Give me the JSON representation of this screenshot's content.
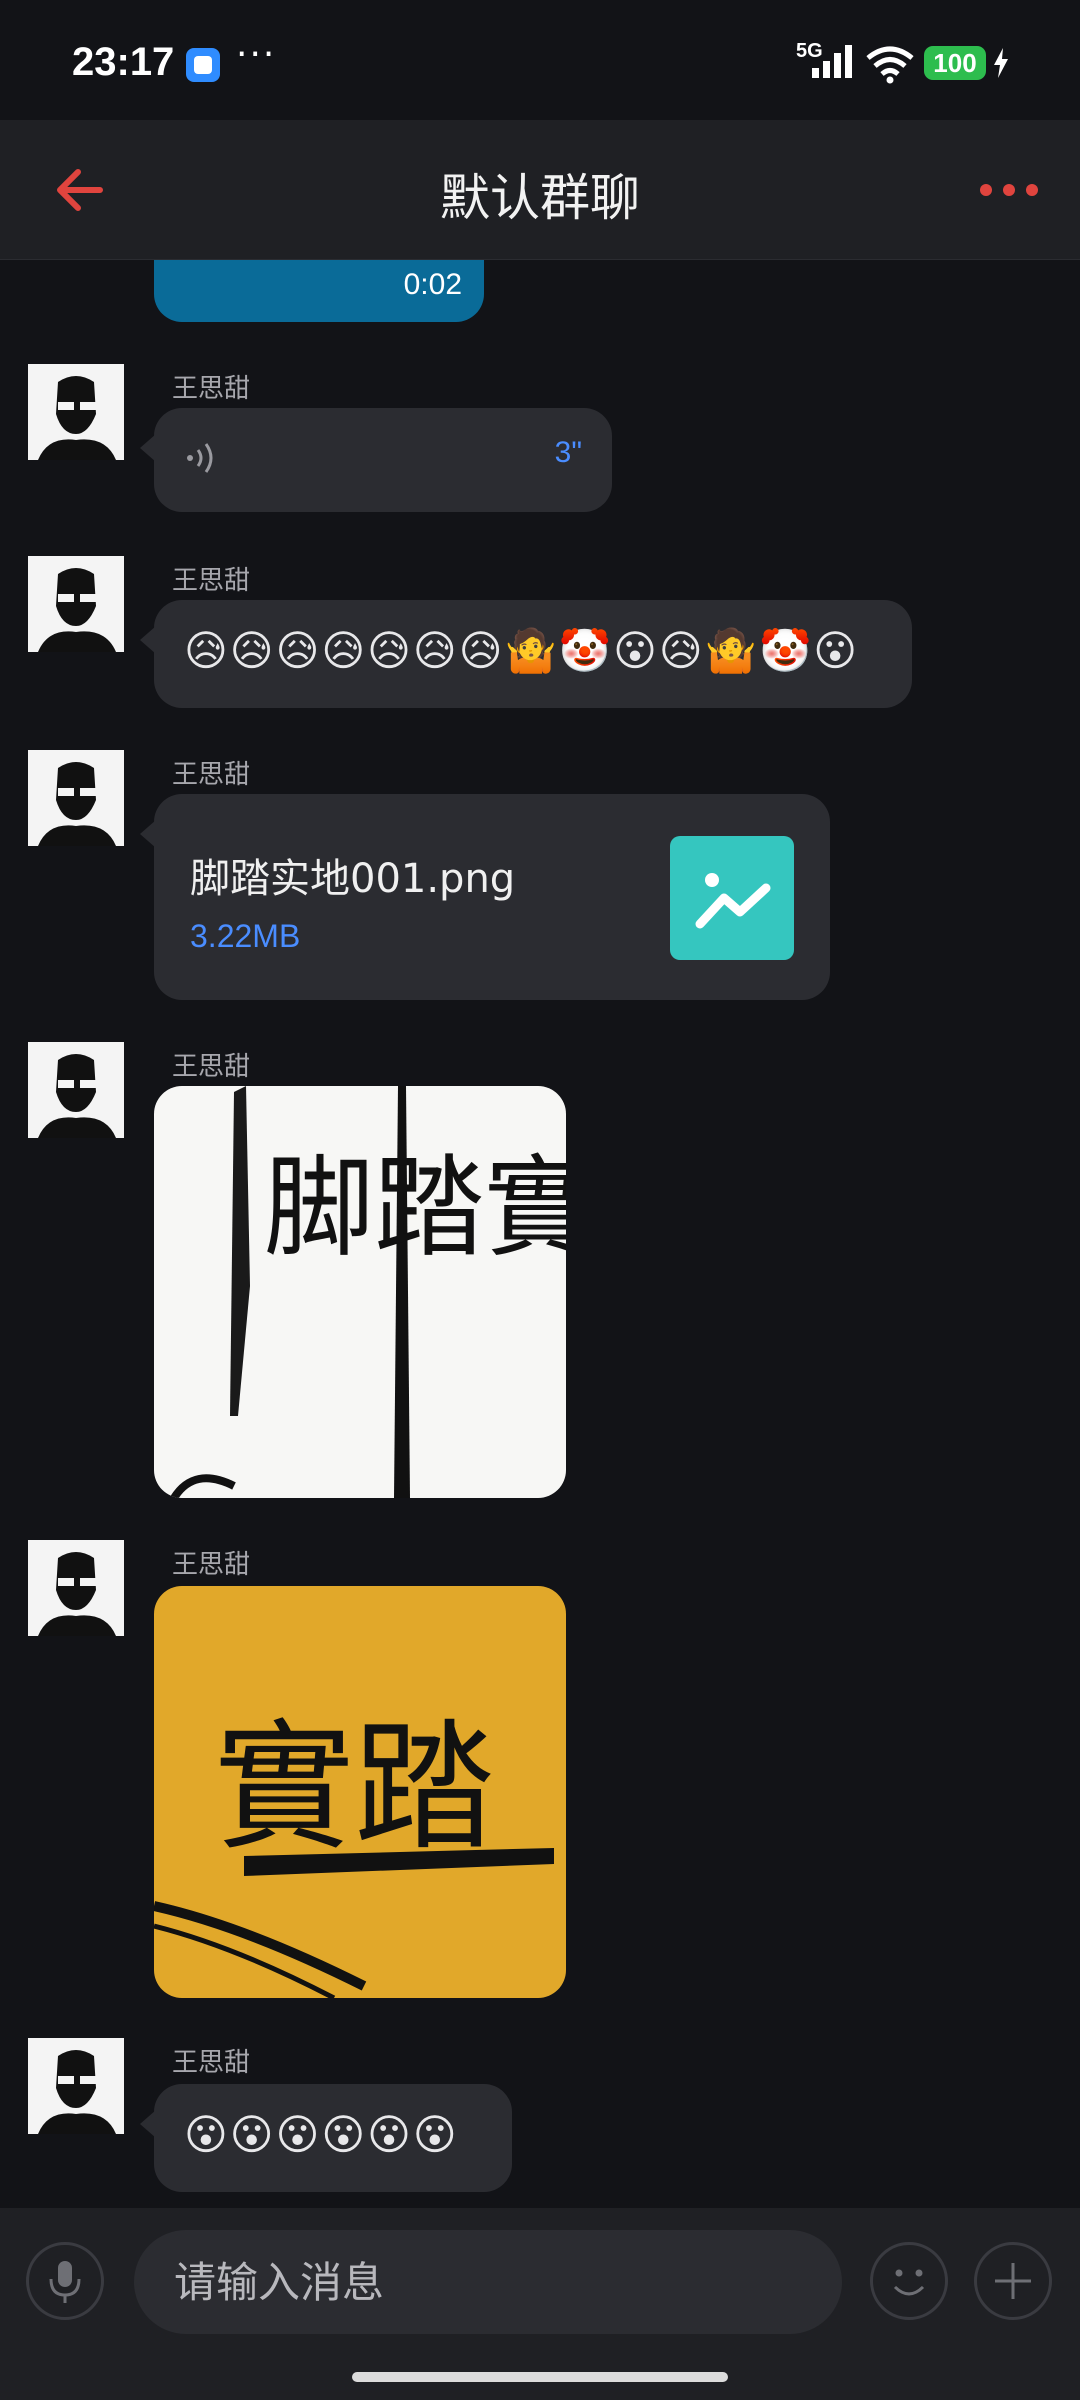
{
  "status_bar": {
    "time": "23:17",
    "more": "···",
    "network": "5G",
    "battery": "100"
  },
  "header": {
    "title": "默认群聊",
    "back_icon": "arrow-left-icon",
    "menu_icon": "more-dots-icon",
    "accent_color": "#e0443e"
  },
  "messages": {
    "own_voice": {
      "duration": "0:02"
    },
    "m1": {
      "sender": "王思甜",
      "voice_duration": "3\""
    },
    "m2": {
      "sender": "王思甜",
      "emojis": "😥😥😥😥😥😥😥🤷🤡😮😥🤷🤡😮"
    },
    "m3": {
      "sender": "王思甜",
      "file_name": "脚踏实地001.png",
      "file_size": "3.22MB"
    },
    "m4": {
      "sender": "王思甜",
      "image_text": "脚踏實"
    },
    "m5": {
      "sender": "王思甜",
      "image_text": "實踏"
    },
    "m6": {
      "sender": "王思甜",
      "emojis": "😮😮😮😮😮😮"
    }
  },
  "composer": {
    "placeholder": "请输入消息",
    "mic_icon": "microphone-icon",
    "emoji_icon": "smiley-icon",
    "plus_icon": "plus-icon"
  }
}
